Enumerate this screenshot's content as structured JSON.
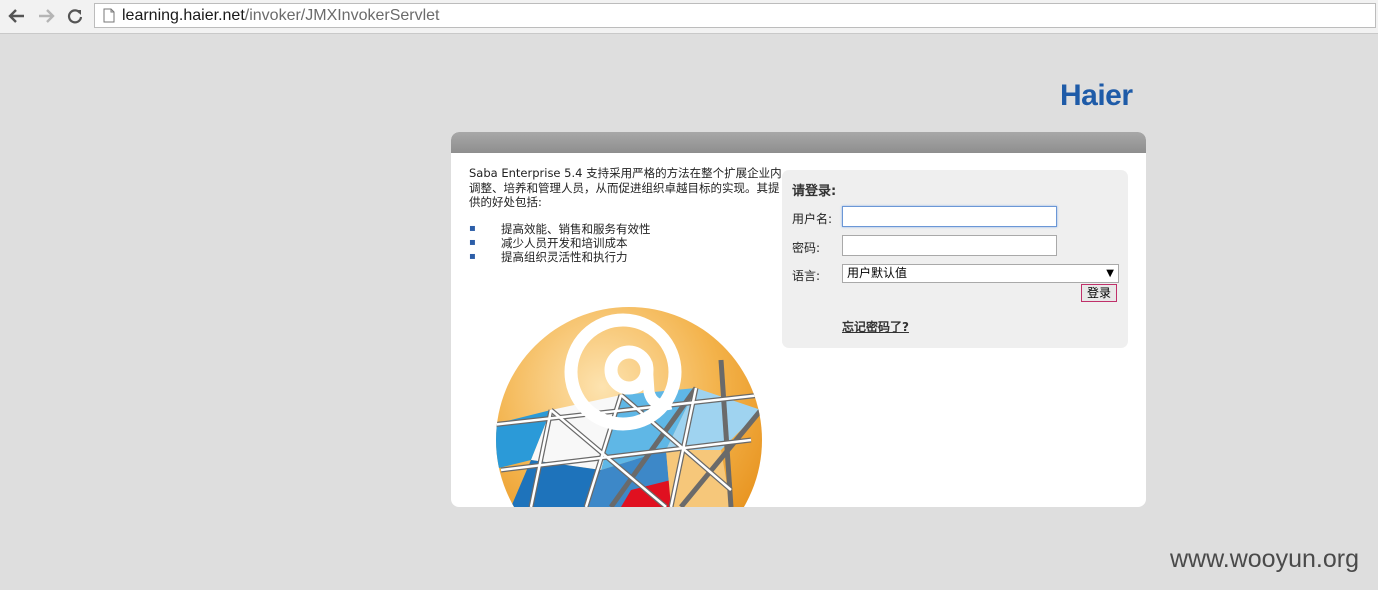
{
  "browser": {
    "url_host": "learning.haier.net",
    "url_path": "/invoker/JMXInvokerServlet",
    "icons": [
      "back-arrow-icon",
      "forward-arrow-icon",
      "reload-icon",
      "page-icon"
    ]
  },
  "brand": {
    "logo_text": "Haier",
    "color": "#1e5ba8"
  },
  "intro": {
    "text": "Saba Enterprise 5.4 支持采用严格的方法在整个扩展企业内调整、培养和管理人员，从而促进组织卓越目标的实现。其提供的好处包括:",
    "benefits": [
      "提高效能、销售和服务有效性",
      "减少人员开发和培训成本",
      "提高组织灵活性和执行力"
    ]
  },
  "login": {
    "title": "请登录:",
    "username_label": "用户名:",
    "password_label": "密码:",
    "language_label": "语言:",
    "username_value": "",
    "password_value": "",
    "language_selected": "用户默认值",
    "submit_label": "登录",
    "forgot_label": "忘记密码了?"
  },
  "watermark": "www.wooyun.org"
}
